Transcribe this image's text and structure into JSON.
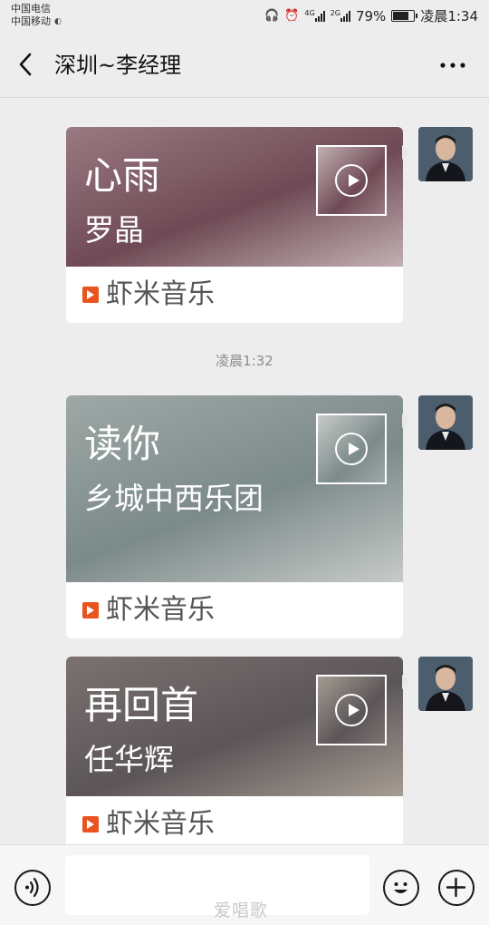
{
  "status_bar": {
    "carrier_1": "中国电信",
    "carrier_2": "中国移动",
    "network_1": "4G",
    "network_2": "2G",
    "battery": "79%",
    "battery_level": 0.79,
    "time": "凌晨1:34"
  },
  "nav": {
    "title": "深圳~李经理"
  },
  "messages": [
    {
      "title": "心雨",
      "artist": "罗晶",
      "source": "虾米音乐",
      "cover_icon": "album-cover-play-icon",
      "colors": {
        "from": "#6f4a55",
        "mid": "#9a7a82",
        "to": "#c2b0b3"
      }
    },
    {
      "title": "读你",
      "artist": "乡城中西乐团",
      "source": "虾米音乐",
      "cover_icon": "album-cover-play-icon",
      "colors": {
        "from": "#7c8a8a",
        "mid": "#9ea8a6",
        "to": "#c7cbc8"
      }
    },
    {
      "title": "再回首",
      "artist": "任华辉",
      "source": "虾米音乐",
      "cover_icon": "album-cover-play-icon",
      "colors": {
        "from": "#5c5558",
        "mid": "#7b7270",
        "to": "#a59c92"
      }
    }
  ],
  "timestamp": "凌晨1:32",
  "input_bar": {
    "value": "",
    "icons": [
      "voice-icon",
      "emoji-icon",
      "plus-icon"
    ]
  },
  "watermark": "爱唱歌"
}
